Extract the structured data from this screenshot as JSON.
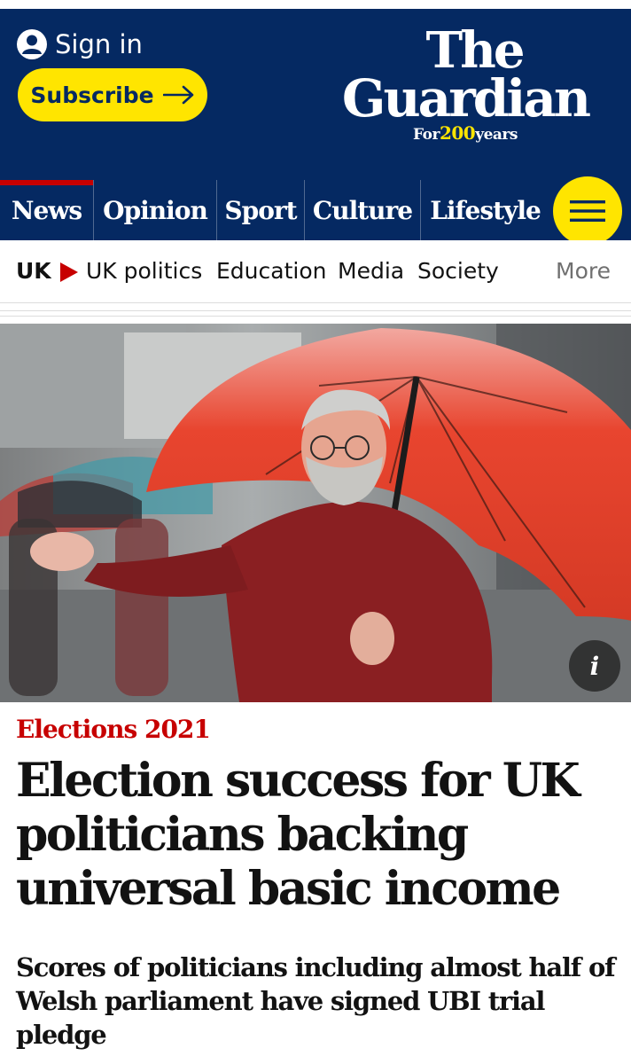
{
  "header": {
    "sign_in_label": "Sign in",
    "subscribe_label": "Subscribe",
    "logo": {
      "line1": "The",
      "line2": "Guardian",
      "tag_prefix": "For",
      "tag_number": "200",
      "tag_suffix": "years"
    }
  },
  "pillars": [
    {
      "label": "News",
      "active": true
    },
    {
      "label": "Opinion"
    },
    {
      "label": "Sport"
    },
    {
      "label": "Culture"
    },
    {
      "label": "Lifestyle"
    }
  ],
  "subnav": {
    "current": "UK",
    "items": [
      "UK politics",
      "Education",
      "Media",
      "Society"
    ],
    "more_label": "More"
  },
  "article": {
    "info_label": "i",
    "kicker": "Elections 2021",
    "headline": "Election success for UK politicians backing universal basic income",
    "standfirst": "Scores of politicians including almost half of Welsh parliament have signed UBI trial pledge"
  },
  "colors": {
    "brand_blue": "#052962",
    "brand_yellow": "#ffe500",
    "news_red": "#c70000",
    "text": "#121212"
  },
  "icons": {
    "sign_in": "user-icon",
    "subscribe": "arrow-right-icon",
    "menu": "hamburger-menu-icon",
    "subnav_current": "triangle-right-icon",
    "photo": "image-info-icon"
  }
}
